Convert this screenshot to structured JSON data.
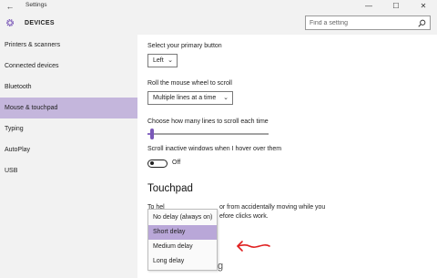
{
  "window": {
    "title": "Settings",
    "back_glyph": "←",
    "minimize_glyph": "—",
    "maximize_glyph": "☐",
    "close_glyph": "✕"
  },
  "header": {
    "icon": "gear-icon",
    "title": "DEVICES",
    "search_placeholder": "Find a setting"
  },
  "sidebar": {
    "items": [
      {
        "label": "Printers & scanners",
        "active": false
      },
      {
        "label": "Connected devices",
        "active": false
      },
      {
        "label": "Bluetooth",
        "active": false
      },
      {
        "label": "Mouse & touchpad",
        "active": true
      },
      {
        "label": "Typing",
        "active": false
      },
      {
        "label": "AutoPlay",
        "active": false
      },
      {
        "label": "USB",
        "active": false
      }
    ]
  },
  "main": {
    "primary_button": {
      "label": "Select your primary button",
      "value": "Left"
    },
    "wheel_scroll": {
      "label": "Roll the mouse wheel to scroll",
      "value": "Multiple lines at a time"
    },
    "lines_to_scroll": {
      "label": "Choose how many lines to scroll each time",
      "level": 0.03
    },
    "inactive_scroll": {
      "label": "Scroll inactive windows when I hover over them",
      "state": "Off"
    },
    "touchpad": {
      "heading": "Touchpad",
      "line1_left": "To hel",
      "line1_right": "or from accidentally moving while you",
      "line2_right": "efore clicks work.",
      "partial_text": "g"
    }
  },
  "delay_menu": {
    "options": [
      "No delay (always on)",
      "Short delay",
      "Medium delay",
      "Long delay"
    ],
    "selected": "Short delay"
  },
  "colors": {
    "accent": "#7a58b8",
    "sidebar_active": "#c4b6dc",
    "menu_selected": "#b9a7d8",
    "annotation_arrow": "#e02020"
  }
}
